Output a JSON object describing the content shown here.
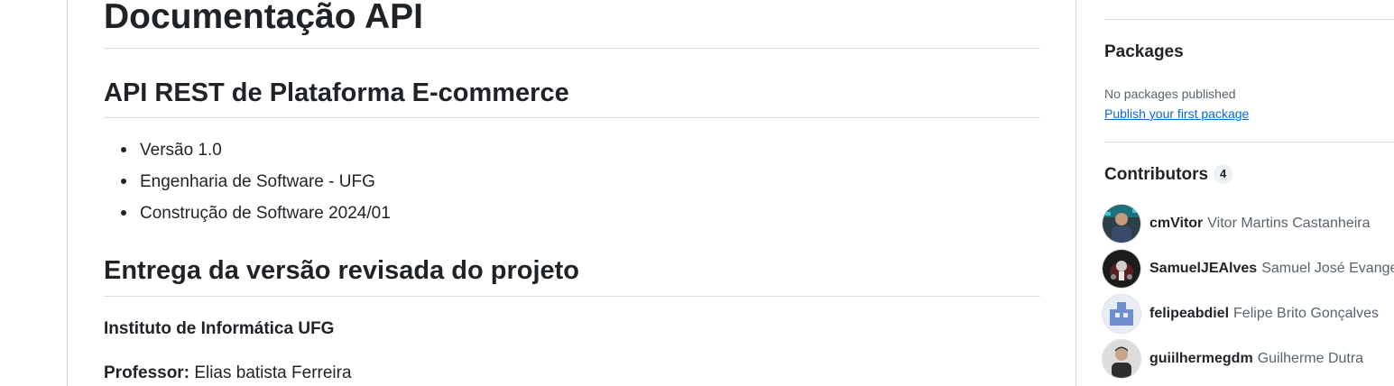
{
  "readme": {
    "title": "Documentação API",
    "section1": {
      "heading": "API REST de Plataforma E-commerce",
      "items": [
        {
          "text": "Versão 1.0"
        },
        {
          "text": "Engenharia de Software - UFG"
        },
        {
          "text": "Construção de Software 2024/01"
        }
      ]
    },
    "section2": {
      "heading": "Entrega da versão revisada do projeto",
      "institute": "Instituto de Informática UFG",
      "professor_label": "Professor:",
      "professor_name": "Elias batista Ferreira"
    }
  },
  "sidebar": {
    "packages": {
      "heading": "Packages",
      "empty_text": "No packages published",
      "link": "Publish your first package"
    },
    "contributors": {
      "heading": "Contributors",
      "count": "4",
      "list": [
        {
          "login": "cmVitor",
          "name": "Vitor Martins Castanheira",
          "avatar": "photo-dark-blue"
        },
        {
          "login": "SamuelJEAlves",
          "name": "Samuel José Evangelista Alves",
          "avatar": "photo-dark"
        },
        {
          "login": "felipeabdiel",
          "name": "Felipe Brito Gonçalves",
          "avatar": "identicon-blue"
        },
        {
          "login": "guiilhermegdm",
          "name": "Guilherme Dutra",
          "avatar": "photo-person"
        }
      ]
    }
  },
  "colors": {
    "link": "#0969da",
    "text": "#1f2328",
    "muted": "#59636e",
    "border": "#d0d7de"
  }
}
